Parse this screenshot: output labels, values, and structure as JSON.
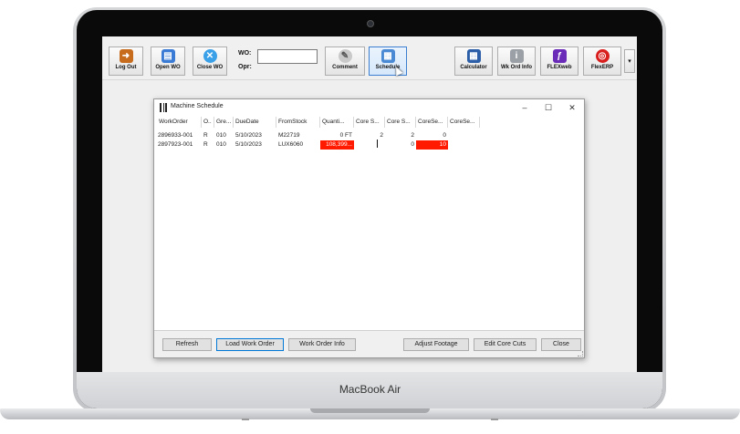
{
  "device": {
    "brand_label": "MacBook Air"
  },
  "toolbar": {
    "buttons": [
      {
        "label": "Log Out",
        "icon": "logout-door-icon",
        "color": "#c76b1d"
      },
      {
        "label": "Open WO",
        "icon": "open-work-order-icon",
        "color": "#3a7bd5"
      },
      {
        "label": "Close WO",
        "icon": "close-x-icon",
        "color": "#3aa0e8"
      },
      {
        "label": "Comment",
        "icon": "pen-icon",
        "color": "#b9b9b9"
      },
      {
        "label": "Schedule",
        "icon": "schedule-icon",
        "color": "#4a8ad4"
      },
      {
        "label": "Calculator",
        "icon": "calculator-icon",
        "color": "#2d5fa8"
      },
      {
        "label": "Wk Ord Info",
        "icon": "document-info-icon",
        "color": "#9aa0a6"
      },
      {
        "label": "FLEXweb",
        "icon": "flexweb-logo-icon",
        "color": "#6a2bb8"
      },
      {
        "label": "FlexERP",
        "icon": "flexerp-logo-icon",
        "color": "#d91e1e"
      }
    ],
    "wo_label": "WO:",
    "opr_label": "Opr:",
    "wo_value": "",
    "more_glyph": "▾"
  },
  "dialog": {
    "title": "Machine Schedule",
    "controls": {
      "minimize": "–",
      "maximize": "☐",
      "close": "✕"
    },
    "columns": [
      "WorkOrder",
      "O..",
      "Gre...",
      "DueDate",
      "FromStock",
      "Quanti...",
      "Core S...",
      "Core S...",
      "CoreSe...",
      "CoreSe..."
    ],
    "rows": [
      [
        "2896933-001",
        "R",
        "010",
        "5/10/2023",
        "M22719",
        "0 FT",
        "2",
        "2",
        "0",
        ""
      ],
      [
        "2897923-001",
        "R",
        "010",
        "5/10/2023",
        "LUX6060",
        "108,399...",
        "",
        "0",
        "10",
        ""
      ]
    ],
    "highlight_color": "#ff1a00",
    "buttons": {
      "refresh": "Refresh",
      "load_work_order": "Load Work Order",
      "work_order_info": "Work Order Info",
      "adjust_footage": "Adjust Footage",
      "edit_core_cuts": "Edit Core Cuts",
      "close": "Close"
    }
  }
}
